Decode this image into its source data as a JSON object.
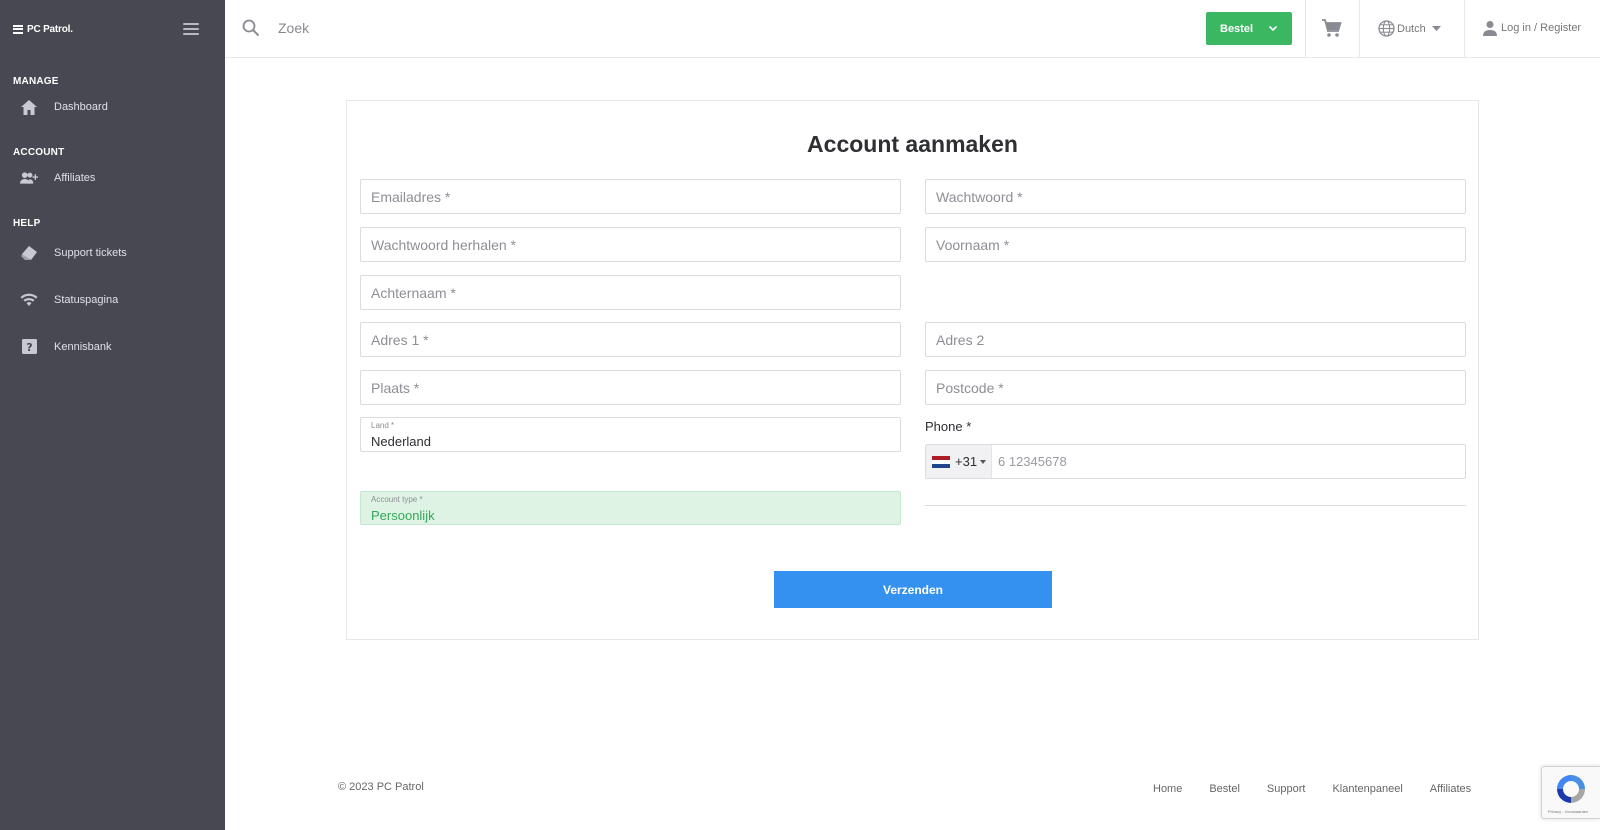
{
  "sidebar": {
    "logo_text": "PC Patrol.",
    "sections": [
      {
        "title": "MANAGE",
        "items": [
          {
            "label": "Dashboard",
            "icon": "home-icon"
          }
        ]
      },
      {
        "title": "ACCOUNT",
        "items": [
          {
            "label": "Affiliates",
            "icon": "users-add-icon"
          }
        ]
      },
      {
        "title": "HELP",
        "items": [
          {
            "label": "Support tickets",
            "icon": "ticket-icon"
          },
          {
            "label": "Statuspagina",
            "icon": "wifi-icon"
          },
          {
            "label": "Kennisbank",
            "icon": "help-box-icon"
          }
        ]
      }
    ]
  },
  "topbar": {
    "search_placeholder": "Zoek",
    "order_button": "Bestel",
    "language": "Dutch",
    "login": "Log in / Register"
  },
  "form": {
    "title": "Account aanmaken",
    "email_placeholder": "Emailadres *",
    "password_placeholder": "Wachtwoord *",
    "password_repeat_placeholder": "Wachtwoord herhalen *",
    "firstname_placeholder": "Voornaam *",
    "lastname_placeholder": "Achternaam *",
    "address1_placeholder": "Adres 1 *",
    "address2_placeholder": "Adres 2",
    "city_placeholder": "Plaats *",
    "postcode_placeholder": "Postcode *",
    "country": {
      "label": "Land *",
      "value": "Nederland"
    },
    "phone": {
      "label": "Phone *",
      "country_code": "+31",
      "placeholder": "6 12345678"
    },
    "account_type": {
      "label": "Account type *",
      "value": "Persoonlijk"
    },
    "submit": "Verzenden"
  },
  "footer": {
    "copyright": "© 2023 PC Patrol",
    "links": [
      "Home",
      "Bestel",
      "Support",
      "Klantenpaneel",
      "Affiliates"
    ]
  },
  "recaptcha": {
    "text": "Privacy - Voorwaarden"
  },
  "colors": {
    "sidebar_bg": "#474851",
    "accent_green": "#3cb761",
    "submit_blue": "#3591ef",
    "account_type_bg": "#dff3e5"
  }
}
